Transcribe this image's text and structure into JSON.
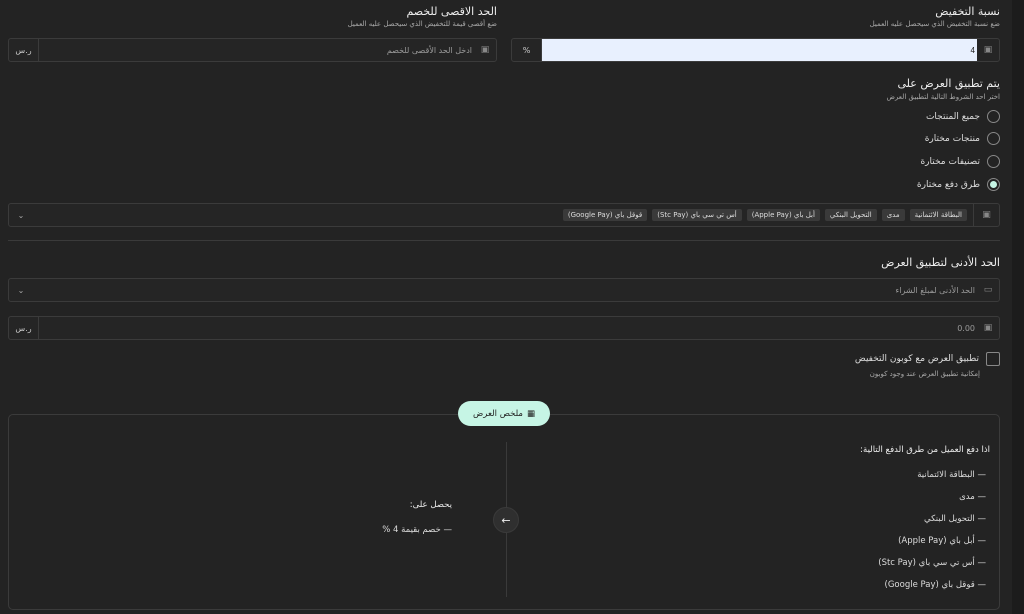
{
  "discount_rate": {
    "title": "نسبة التخفيض",
    "subtitle": "ضع نسبة التخفيض الذي سيحصل عليه العميل",
    "value": "4",
    "unit": "%"
  },
  "max_discount": {
    "title": "الحد الاقصى للخصم",
    "subtitle": "ضع أقصى قيمة للتخفيض الذي سيحصل عليه العميل",
    "placeholder": "ادخل الحد الأقصى للخصم",
    "unit": "ر.س"
  },
  "apply_on": {
    "title": "يتم تطبيق العرض على",
    "subtitle": "اختر احد الشروط التالية لتطبيق العرض",
    "options": [
      "جميع المنتجات",
      "منتجات مختارة",
      "تصنيفات مختارة",
      "طرق دفع مختارة"
    ],
    "selected": 3
  },
  "payment_tags": [
    "البطاقة الائتمانية",
    "مدى",
    "التحويل البنكي",
    "أبل باي (Apple Pay)",
    "أس تي سي باي (Stc Pay)",
    "قوقل باي (Google Pay)"
  ],
  "min_apply": {
    "title": "الحد الأدنى لتطبيق العرض",
    "select_value": "الحد الأدنى لمبلغ الشراء",
    "amount_value": "0.00",
    "unit": "ر.س"
  },
  "coupon": {
    "label": "تطبيق العرض مع كوبون التخفيض",
    "subtitle": "إمكانية تطبيق العرض عند وجود كوبون"
  },
  "summary": {
    "badge": "ملخص العرض",
    "condition_title": "اذا دفع العميل من طرق الدفع التالية:",
    "methods": [
      "البطاقة الائتمانية",
      "مدى",
      "التحويل البنكي",
      "أبل باي (Apple Pay)",
      "أس تي سي باي (Stc Pay)",
      "قوقل باي (Google Pay)"
    ],
    "result_title": "يحصل على:",
    "result_item": "خصم بقيمة 4 %"
  },
  "colors": {
    "accent": "#c6f5e5",
    "background": "#232323"
  }
}
